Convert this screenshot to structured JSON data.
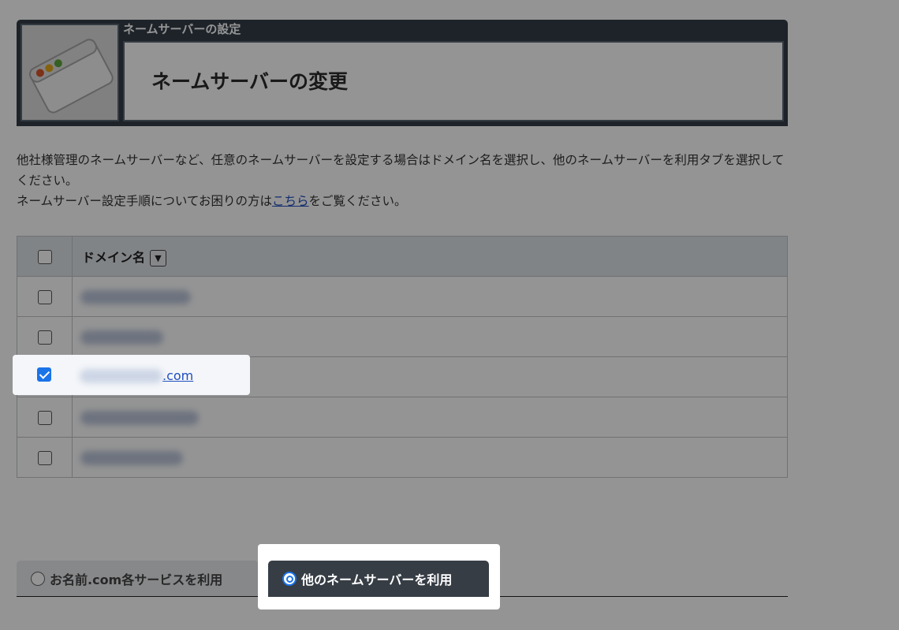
{
  "header": {
    "breadcrumb": "ネームサーバーの設定",
    "title": "ネームサーバーの変更"
  },
  "description": {
    "line1": "他社様管理のネームサーバーなど、任意のネームサーバーを設定する場合はドメイン名を選択し、他のネームサーバーを利用タブを選択してください。",
    "line2_prefix": "ネームサーバー設定手順についてお困りの方は",
    "line2_link": "こちら",
    "line2_suffix": "をご覧ください。"
  },
  "table": {
    "header_label": "ドメイン名",
    "sort_icon": "▼",
    "rows": [
      {
        "domain_visible": "",
        "checked": false
      },
      {
        "domain_visible": "",
        "checked": false
      },
      {
        "domain_visible": ".com",
        "checked": true
      },
      {
        "domain_visible": "",
        "checked": false
      },
      {
        "domain_visible": "",
        "checked": false
      }
    ]
  },
  "tabs": {
    "onamae_label": "お名前.com各サービスを利用",
    "other_label": "他のネームサーバーを利用",
    "selected": "other"
  },
  "colors": {
    "header_bg": "#333d47",
    "accent": "#1a73e8",
    "link": "#1f4fbf",
    "active_tab": "#363d45"
  }
}
